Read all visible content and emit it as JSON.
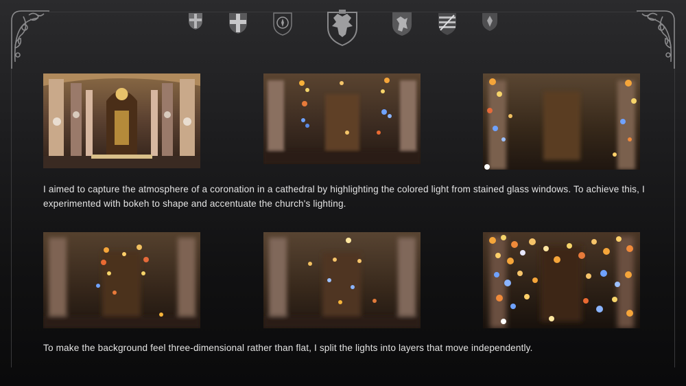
{
  "captions": {
    "first": "I aimed to capture the atmosphere of a coronation in a cathedral by highlighting the colored light from stained glass windows. To achieve this, I experimented with bokeh to shape and accentuate the church's lighting.",
    "second": "To make the background feel three-dimensional rather than flat, I split the lights into layers that move independently."
  },
  "photos": [
    {
      "id": "sharp",
      "blur": 0
    },
    {
      "id": "bokeh-1",
      "blur": 1
    },
    {
      "id": "bokeh-2",
      "blur": 1
    },
    {
      "id": "bokeh-3",
      "blur": 1
    },
    {
      "id": "bokeh-4",
      "blur": 1
    },
    {
      "id": "bokeh-5",
      "blur": 1
    }
  ],
  "crest_icons": [
    "cross-shield-icon",
    "cross-shield-icon",
    "round-seal-icon",
    "double-eagle-crest-icon",
    "lion-shield-icon",
    "striped-shield-icon",
    "emblem-shield-icon"
  ],
  "colors": {
    "background": "#1d1d1f",
    "ornament": "#8a8a8c",
    "text": "#e4e4e4",
    "gold_light": "#f2b23c",
    "blue_light": "#6fa2ff"
  }
}
